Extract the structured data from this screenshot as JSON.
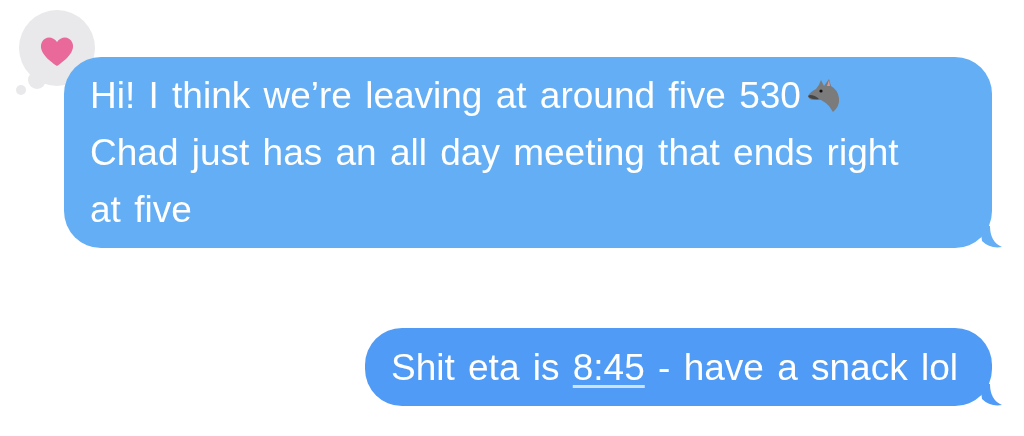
{
  "messages": [
    {
      "kind": "plain",
      "hearted": true,
      "text_before": "Hi! I think we’re leaving at around five 530",
      "has_emoji": true,
      "text_after": "Chad just has an all day meeting that ends right at five"
    },
    {
      "kind": "link",
      "text_before": "Shit eta is ",
      "link": "8:45",
      "text_after": " - have a snack lol"
    }
  ]
}
